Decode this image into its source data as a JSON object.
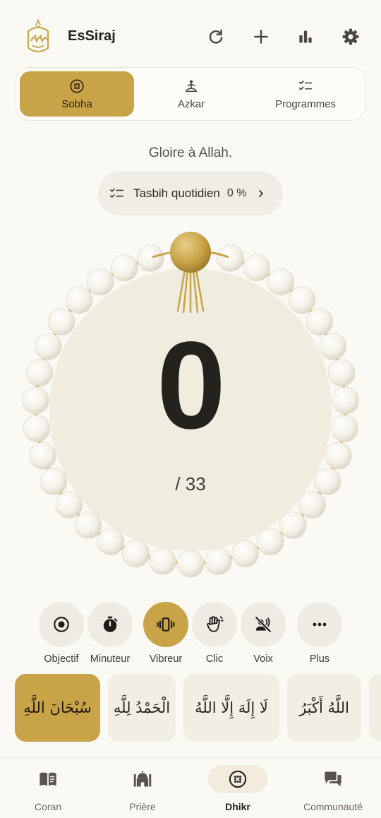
{
  "app": {
    "title": "EsSiraj"
  },
  "header": {
    "actions": [
      {
        "icon": "refresh-icon"
      },
      {
        "icon": "plus-icon"
      },
      {
        "icon": "stats-icon"
      },
      {
        "icon": "gear-icon"
      }
    ]
  },
  "tabs": [
    {
      "label": "Sobha",
      "icon": "beads-icon",
      "active": true
    },
    {
      "label": "Azkar",
      "icon": "meditation-icon",
      "active": false
    },
    {
      "label": "Programmes",
      "icon": "checklist-icon",
      "active": false
    }
  ],
  "dhikr": {
    "meaning": "Gloire à Allah."
  },
  "daily": {
    "label": "Tasbih quotidien",
    "percent": "0 %"
  },
  "counter": {
    "count": "0",
    "target": "/ 33"
  },
  "controls": [
    {
      "label": "Objectif",
      "icon": "target-icon",
      "active": false
    },
    {
      "label": "Minuteur",
      "icon": "stopwatch-icon",
      "active": false
    },
    {
      "label": "Vibreur",
      "icon": "vibrate-icon",
      "active": true
    },
    {
      "label": "Clic",
      "icon": "hand-icon",
      "active": false
    },
    {
      "label": "Voix",
      "icon": "voice-off-icon",
      "active": false
    },
    {
      "label": "Plus",
      "icon": "more-icon",
      "active": false
    }
  ],
  "phrases": [
    {
      "text": "سُبْحَانَ اللَّهِ",
      "active": true
    },
    {
      "text": "الْحَمْدُ لِلَّهِ",
      "active": false
    },
    {
      "text": "لَا إِلَهَ إِلَّا اللَّهُ",
      "active": false
    },
    {
      "text": "اللَّهُ أَكْبَرُ",
      "active": false
    }
  ],
  "nav": [
    {
      "label": "Coran",
      "icon": "book-icon",
      "active": false
    },
    {
      "label": "Prière",
      "icon": "mosque-icon",
      "active": false
    },
    {
      "label": "Dhikr",
      "icon": "beads-icon",
      "active": true
    },
    {
      "label": "Communauté",
      "icon": "chat-icon",
      "active": false
    }
  ],
  "colors": {
    "accent": "#c9a347",
    "background": "#fbf9f4",
    "surface": "#f0ece0"
  }
}
